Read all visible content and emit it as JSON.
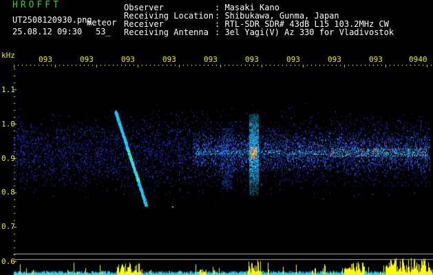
{
  "header": {
    "logo": "HROFFT",
    "filename": "UT2508120930.png",
    "tag": "meteor",
    "datetime": "25.08.12 09:30",
    "count": "53_",
    "fields": [
      {
        "label": "Observer",
        "value": ": Masaki Kano"
      },
      {
        "label": "Receiving Location",
        "value": ": Shibukawa, Gunma, Japan"
      },
      {
        "label": "Receiver",
        "value": ": RTL-SDR SDR# 43dB L15 103.2MHz CW"
      },
      {
        "label": "Receiving Antenna",
        "value": ": 3el Yagi(V) Az 330 for Vladivostok"
      }
    ]
  },
  "axis": {
    "unit": "kHz",
    "y_ticks": [
      "1.1",
      "1.0",
      "0.9",
      "0.8",
      "0.7",
      "0.6"
    ],
    "x_ticks": [
      "093",
      "093",
      "093",
      "093",
      "093",
      "093",
      "093",
      "093",
      "093",
      "0940"
    ]
  },
  "colors": {
    "background": "#000000",
    "text": "#ffffff",
    "logo": "#29d429",
    "ticks": "#f0f000",
    "noise": "#2a3cff",
    "signal": "#00e8ff",
    "hot": "#ff3030",
    "bars": "#ffff00"
  }
}
